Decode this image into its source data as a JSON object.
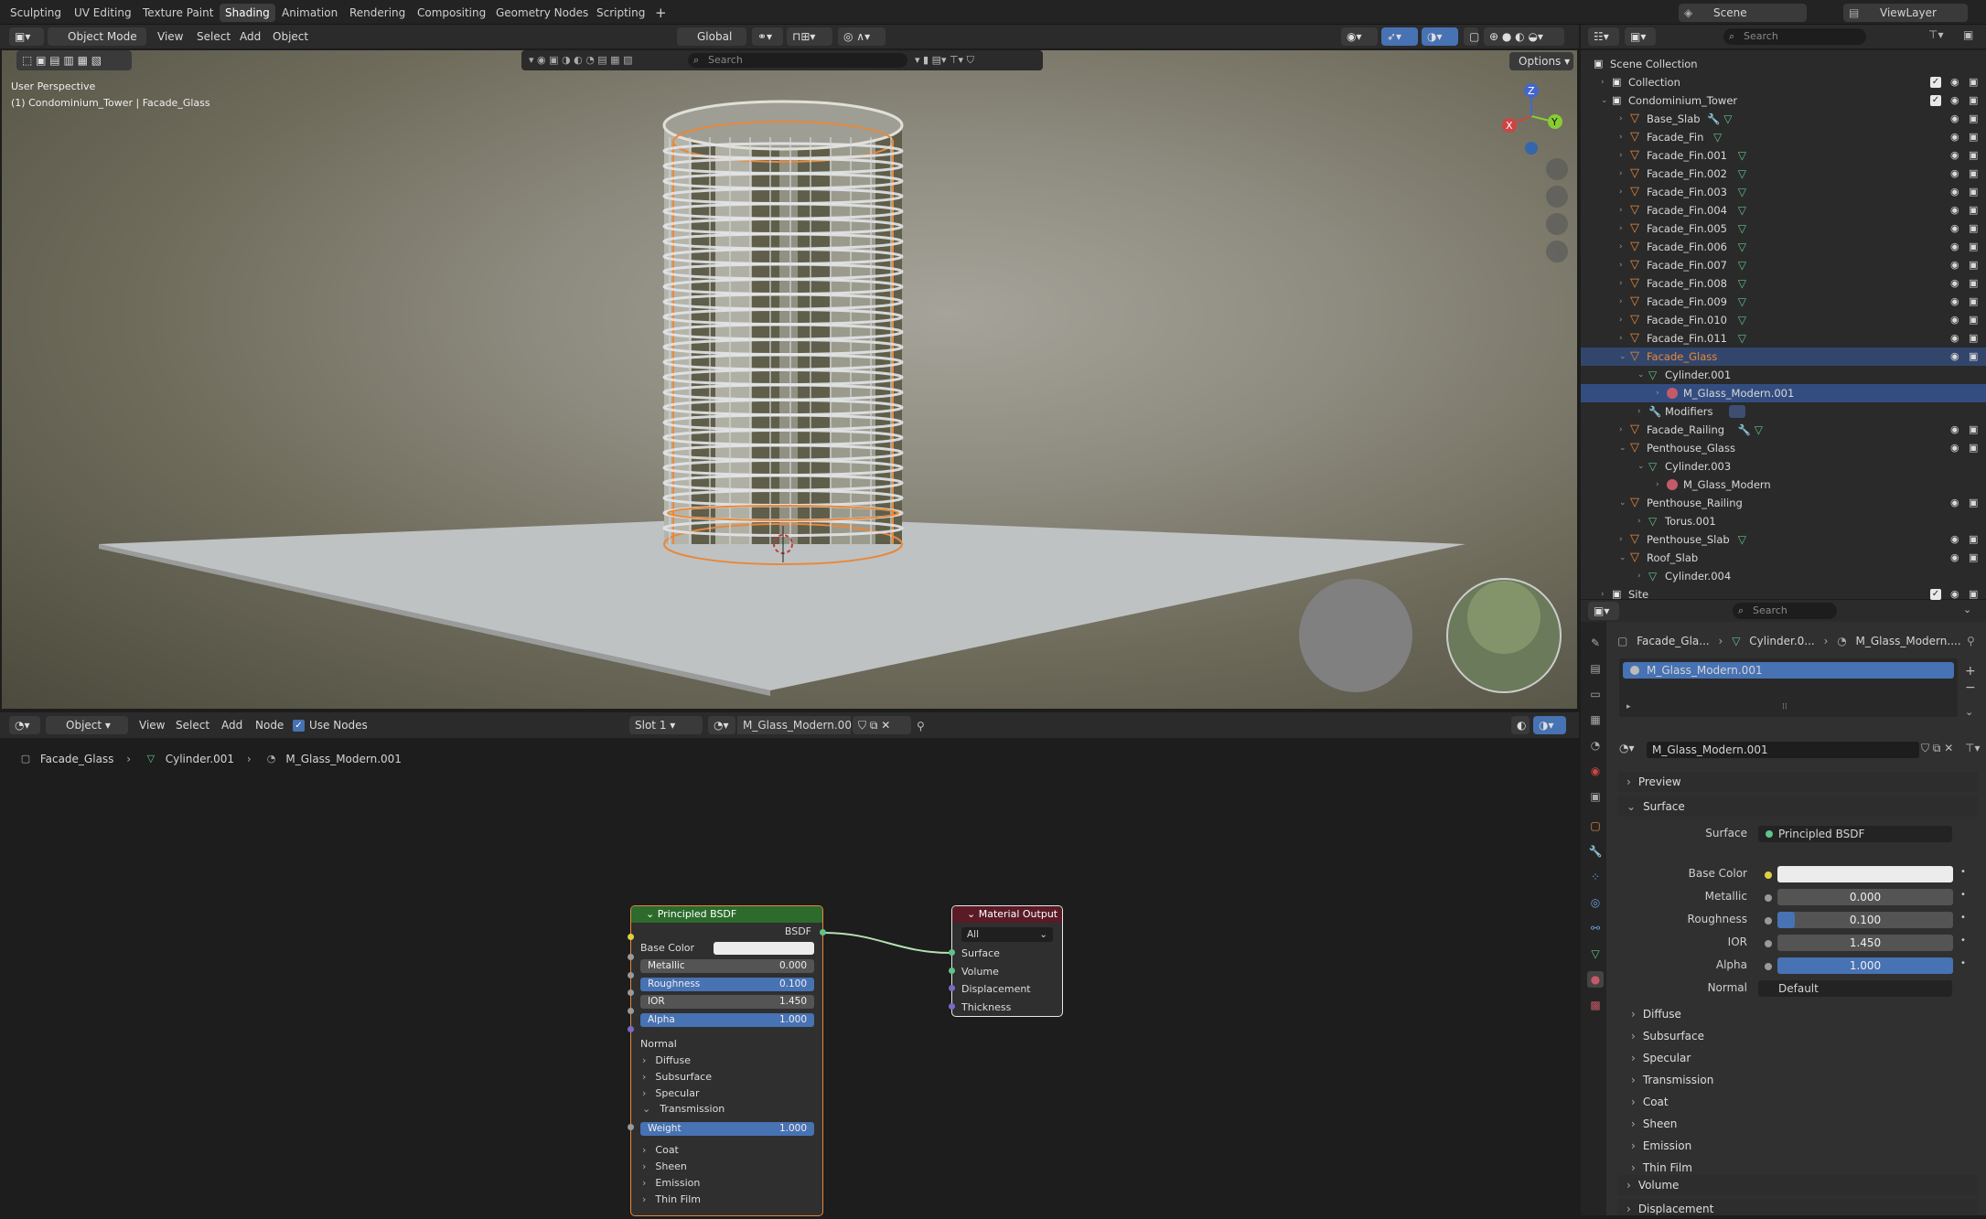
{
  "workspaces": [
    "Sculpting",
    "UV Editing",
    "Texture Paint",
    "Shading",
    "Animation",
    "Rendering",
    "Compositing",
    "Geometry Nodes",
    "Scripting"
  ],
  "active_workspace": "Shading",
  "scene": {
    "name": "Scene",
    "view_layer": "ViewLayer"
  },
  "viewport": {
    "mode": "Object Mode",
    "menus": [
      "View",
      "Select",
      "Add",
      "Object"
    ],
    "transform": "Global",
    "search_placeholder": "Search",
    "options": "Options",
    "overlay_line1": "User Perspective",
    "overlay_line2": "(1) Condominium_Tower | Facade_Glass",
    "gizmo": {
      "x": "X",
      "y": "Y",
      "z": "Z"
    }
  },
  "outliner": {
    "search_placeholder": "Search",
    "rows": [
      {
        "label": "Scene Collection",
        "kind": "scene",
        "indent": 0
      },
      {
        "label": "Collection",
        "kind": "coll",
        "indent": 1
      },
      {
        "label": "Condominium_Tower",
        "kind": "coll",
        "indent": 1,
        "open": true
      },
      {
        "label": "Base_Slab",
        "kind": "obj",
        "indent": 2,
        "mod": true,
        "mesh": true
      },
      {
        "label": "Facade_Fin",
        "kind": "obj",
        "indent": 2,
        "mesh": true
      },
      {
        "label": "Facade_Fin.001",
        "kind": "obj",
        "indent": 2,
        "mesh": true
      },
      {
        "label": "Facade_Fin.002",
        "kind": "obj",
        "indent": 2,
        "mesh": true
      },
      {
        "label": "Facade_Fin.003",
        "kind": "obj",
        "indent": 2,
        "mesh": true
      },
      {
        "label": "Facade_Fin.004",
        "kind": "obj",
        "indent": 2,
        "mesh": true
      },
      {
        "label": "Facade_Fin.005",
        "kind": "obj",
        "indent": 2,
        "mesh": true
      },
      {
        "label": "Facade_Fin.006",
        "kind": "obj",
        "indent": 2,
        "mesh": true
      },
      {
        "label": "Facade_Fin.007",
        "kind": "obj",
        "indent": 2,
        "mesh": true
      },
      {
        "label": "Facade_Fin.008",
        "kind": "obj",
        "indent": 2,
        "mesh": true
      },
      {
        "label": "Facade_Fin.009",
        "kind": "obj",
        "indent": 2,
        "mesh": true
      },
      {
        "label": "Facade_Fin.010",
        "kind": "obj",
        "indent": 2,
        "mesh": true
      },
      {
        "label": "Facade_Fin.011",
        "kind": "obj",
        "indent": 2,
        "mesh": true
      },
      {
        "label": "Facade_Glass",
        "kind": "obj",
        "indent": 2,
        "open": true,
        "active": true
      },
      {
        "label": "Cylinder.001",
        "kind": "meshdata",
        "indent": 3,
        "open": true
      },
      {
        "label": "M_Glass_Modern.001",
        "kind": "mat",
        "indent": 4,
        "selected": true
      },
      {
        "label": "Modifiers",
        "kind": "mods",
        "indent": 3
      },
      {
        "label": "Facade_Railing",
        "kind": "obj",
        "indent": 2,
        "mod": true,
        "mesh": true
      },
      {
        "label": "Penthouse_Glass",
        "kind": "obj",
        "indent": 2,
        "open": true
      },
      {
        "label": "Cylinder.003",
        "kind": "meshdata",
        "indent": 3,
        "open": true
      },
      {
        "label": "M_Glass_Modern",
        "kind": "mat",
        "indent": 4
      },
      {
        "label": "Penthouse_Railing",
        "kind": "obj",
        "indent": 2,
        "open": true
      },
      {
        "label": "Torus.001",
        "kind": "meshdata",
        "indent": 3
      },
      {
        "label": "Penthouse_Slab",
        "kind": "obj",
        "indent": 2,
        "mesh": true
      },
      {
        "label": "Roof_Slab",
        "kind": "obj",
        "indent": 2,
        "open": true
      },
      {
        "label": "Cylinder.004",
        "kind": "meshdata",
        "indent": 3
      },
      {
        "label": "Site",
        "kind": "coll",
        "indent": 1
      }
    ]
  },
  "properties": {
    "search_placeholder": "Search",
    "breadcrumb": [
      "Facade_Gla...",
      "Cylinder.0...",
      "M_Glass_Modern...."
    ],
    "slot_item": "M_Glass_Modern.001",
    "material_name": "M_Glass_Modern.001",
    "panels": {
      "preview": "Preview",
      "surface": "Surface",
      "volume": "Volume",
      "displacement": "Displacement"
    },
    "surface_label": "Surface",
    "surface_value": "Principled BSDF",
    "fields": [
      {
        "label": "Base Color",
        "value": "",
        "kind": "color"
      },
      {
        "label": "Metallic",
        "value": "0.000",
        "kind": "num",
        "fill": 0
      },
      {
        "label": "Roughness",
        "value": "0.100",
        "kind": "num",
        "fill": 0.1
      },
      {
        "label": "IOR",
        "value": "1.450",
        "kind": "num",
        "fill": 0
      },
      {
        "label": "Alpha",
        "value": "1.000",
        "kind": "num",
        "fill": 1
      },
      {
        "label": "Normal",
        "value": "Default",
        "kind": "text"
      }
    ],
    "subpanels": [
      "Diffuse",
      "Subsurface",
      "Specular",
      "Transmission",
      "Coat",
      "Sheen",
      "Emission",
      "Thin Film"
    ]
  },
  "node_editor": {
    "mode": "Object",
    "menus": [
      "View",
      "Select",
      "Add",
      "Node"
    ],
    "use_nodes": "Use Nodes",
    "slot": "Slot 1",
    "material": "M_Glass_Modern.001",
    "breadcrumb": [
      "Facade_Glass",
      "Cylinder.001",
      "M_Glass_Modern.001"
    ],
    "bsdf_node": {
      "title": "Principled BSDF",
      "output": "BSDF",
      "base_color": "Base Color",
      "fields": [
        {
          "label": "Metallic",
          "value": "0.000",
          "fill": 0
        },
        {
          "label": "Roughness",
          "value": "0.100",
          "fill": 1
        },
        {
          "label": "IOR",
          "value": "1.450",
          "fill": 0
        },
        {
          "label": "Alpha",
          "value": "1.000",
          "fill": 1
        }
      ],
      "normal": "Normal",
      "sections_top": [
        "Diffuse",
        "Subsurface",
        "Specular"
      ],
      "transmission": "Transmission",
      "weight_label": "Weight",
      "weight_value": "1.000",
      "sections_bottom": [
        "Coat",
        "Sheen",
        "Emission",
        "Thin Film"
      ]
    },
    "output_node": {
      "title": "Material Output",
      "target": "All",
      "inputs": [
        "Surface",
        "Volume",
        "Displacement",
        "Thickness"
      ]
    }
  },
  "colors": {
    "accent": "#4772b3",
    "orange": "#e8883a",
    "mesh": "#5fc38a",
    "bsdf_header": "#2c6b2c",
    "output_header": "#5a1a26"
  }
}
